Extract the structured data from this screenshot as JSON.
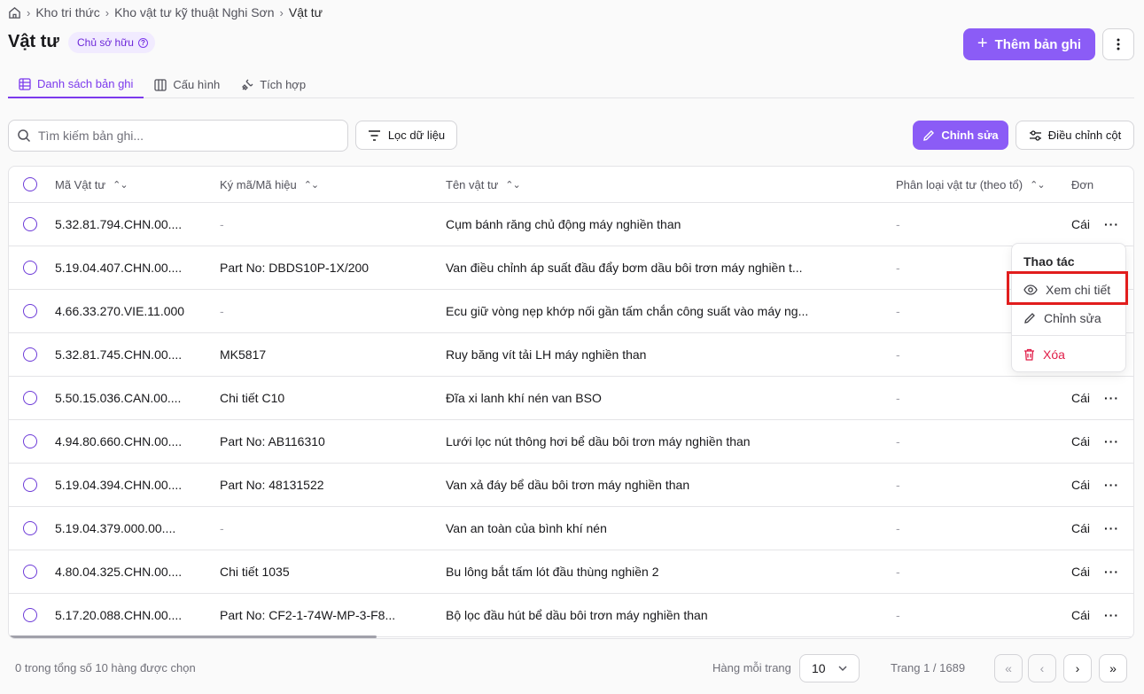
{
  "breadcrumb": {
    "items": [
      "Kho tri thức",
      "Kho vật tư kỹ thuật Nghi Sơn",
      "Vật tư"
    ]
  },
  "header": {
    "title": "Vật tư",
    "owner_badge": "Chủ sở hữu",
    "add_button": "Thêm bản ghi"
  },
  "tabs": [
    {
      "label": "Danh sách bản ghi",
      "active": true
    },
    {
      "label": "Cấu hình",
      "active": false
    },
    {
      "label": "Tích hợp",
      "active": false
    }
  ],
  "toolbar": {
    "search_placeholder": "Tìm kiếm bản ghi...",
    "filter_label": "Lọc dữ liệu",
    "edit_label": "Chỉnh sửa",
    "columns_label": "Điều chỉnh cột"
  },
  "table": {
    "columns": [
      "Mã Vật tư",
      "Ký mã/Mã hiệu",
      "Tên vật tư",
      "Phân loại vật tư (theo tổ)",
      "Đơn"
    ],
    "rows": [
      {
        "code": "5.32.81.794.CHN.00....",
        "mark": "-",
        "name": "Cụm bánh răng chủ động máy nghiền than",
        "category": "-",
        "unit": "Cái"
      },
      {
        "code": "5.19.04.407.CHN.00....",
        "mark": "Part No: DBDS10P-1X/200",
        "name": "Van điều chỉnh áp suất đầu đẩy bơm dầu bôi trơn máy nghiền t...",
        "category": "-",
        "unit": ""
      },
      {
        "code": "4.66.33.270.VIE.11.000",
        "mark": "-",
        "name": "Ecu giữ vòng nẹp khớp nối gần tấm chắn công suất vào máy ng...",
        "category": "-",
        "unit": ""
      },
      {
        "code": "5.32.81.745.CHN.00....",
        "mark": "MK5817",
        "name": "Ruy băng vít tải LH máy nghiền than",
        "category": "-",
        "unit": ""
      },
      {
        "code": "5.50.15.036.CAN.00....",
        "mark": "Chi tiết C10",
        "name": "Đĩa xi lanh khí nén van BSO",
        "category": "-",
        "unit": "Cái"
      },
      {
        "code": "4.94.80.660.CHN.00....",
        "mark": "Part No: AB116310",
        "name": "Lưới lọc nút thông hơi bể dầu bôi trơn máy nghiền than",
        "category": "-",
        "unit": "Cái"
      },
      {
        "code": "5.19.04.394.CHN.00....",
        "mark": "Part No: 48131522",
        "name": "Van xả đáy bể dầu bôi trơn máy nghiền than",
        "category": "-",
        "unit": "Cái"
      },
      {
        "code": "5.19.04.379.000.00....",
        "mark": "-",
        "name": "Van an toàn của bình khí nén",
        "category": "-",
        "unit": "Cái"
      },
      {
        "code": "4.80.04.325.CHN.00....",
        "mark": "Chi tiết 1035",
        "name": "Bu lông bắt tấm lót đầu thùng nghiền 2",
        "category": "-",
        "unit": "Cái"
      },
      {
        "code": "5.17.20.088.CHN.00....",
        "mark": "Part No: CF2-1-74W-MP-3-F8...",
        "name": "Bộ lọc đầu hút bể dầu bôi trơn máy nghiền than",
        "category": "-",
        "unit": "Cái"
      }
    ]
  },
  "menu": {
    "title": "Thao tác",
    "view": "Xem chi tiết",
    "edit": "Chỉnh sửa",
    "delete": "Xóa"
  },
  "footer": {
    "selected_text": "0 trong tổng số 10 hàng được chọn",
    "per_page_label": "Hàng mỗi trang",
    "per_page_value": "10",
    "page_info": "Trang 1 / 1689"
  },
  "colors": {
    "accent": "#8b5cf6",
    "danger": "#e11d48",
    "highlight": "#e11d1d"
  }
}
